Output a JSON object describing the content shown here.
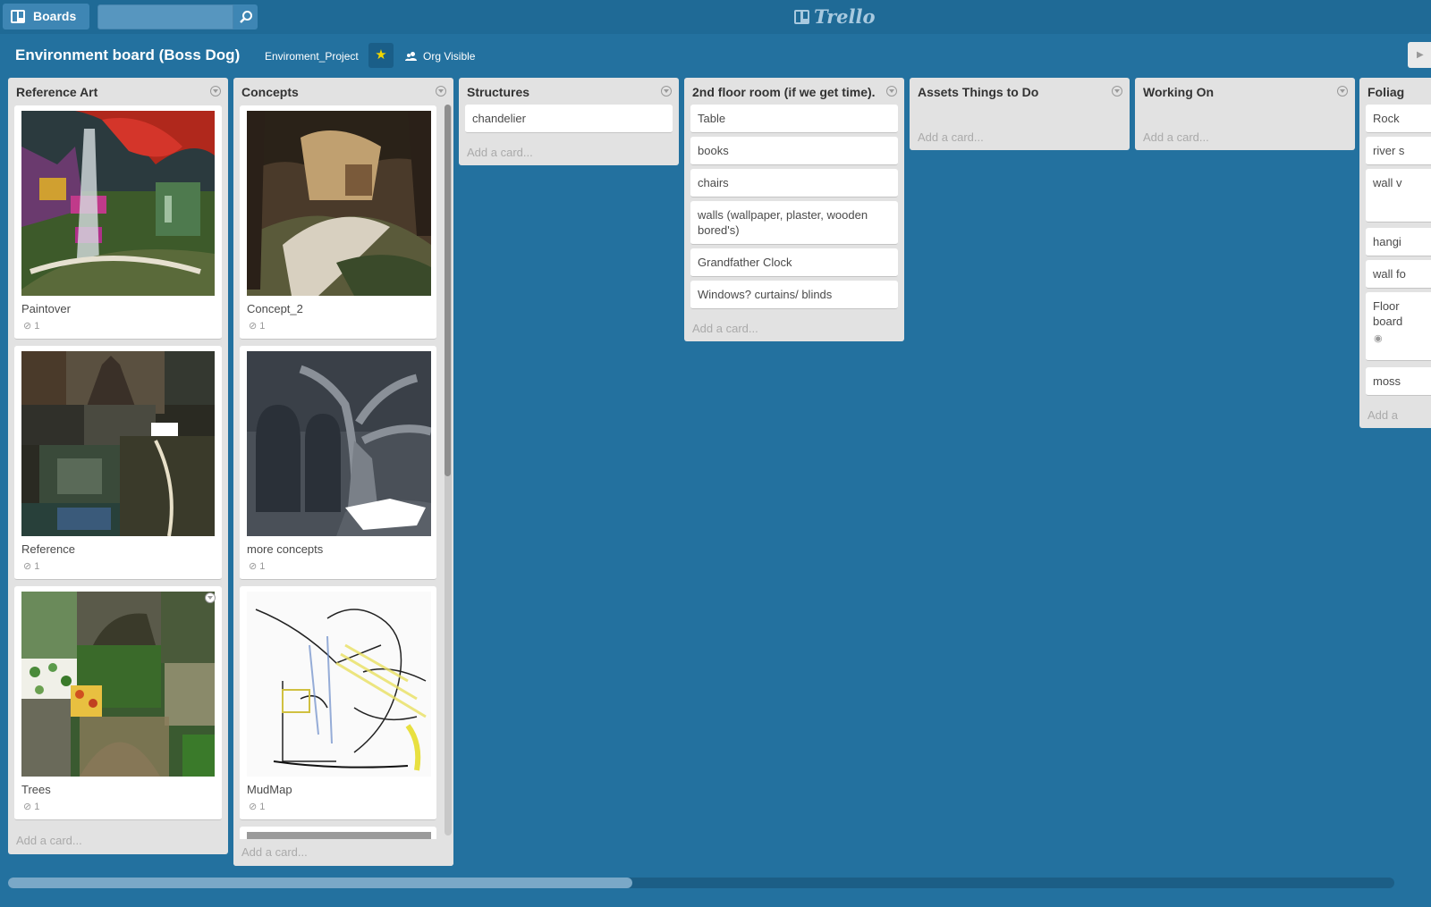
{
  "header": {
    "boards_label": "Boards",
    "search_value": "",
    "logo_text": "Trello"
  },
  "board": {
    "title": "Environment board (Boss Dog)",
    "org": "Enviroment_Project",
    "starred": true,
    "visibility": "Org Visible",
    "add_card_label": "Add a card..."
  },
  "lists": [
    {
      "title": "Reference Art",
      "cards": [
        {
          "title": "Paintover",
          "attachments": "1",
          "cover": "painterly-forest-image"
        },
        {
          "title": "Reference",
          "attachments": "1",
          "cover": "castle-collage-image"
        },
        {
          "title": "Trees",
          "attachments": "1",
          "cover": "trees-collage-image"
        }
      ]
    },
    {
      "title": "Concepts",
      "cards": [
        {
          "title": "Concept_2",
          "attachments": "1",
          "cover": "cave-concept-image"
        },
        {
          "title": "more concepts",
          "attachments": "1",
          "cover": "3d-tree-room-image"
        },
        {
          "title": "MudMap",
          "attachments": "1",
          "cover": "sketch-image"
        }
      ]
    },
    {
      "title": "Structures",
      "cards": [
        {
          "title": "chandelier"
        }
      ]
    },
    {
      "title": "2nd floor room (if we get time).",
      "cards": [
        {
          "title": "Table"
        },
        {
          "title": "books"
        },
        {
          "title": "chairs"
        },
        {
          "title": "walls (wallpaper, plaster, wooden bored's)"
        },
        {
          "title": "Grandfather Clock"
        },
        {
          "title": "Windows? curtains/ blinds"
        }
      ]
    },
    {
      "title": "Assets Things to Do",
      "cards": []
    },
    {
      "title": "Working On",
      "cards": []
    },
    {
      "title": "Foliag",
      "cards": [
        {
          "title": "Rock"
        },
        {
          "title": "river s"
        },
        {
          "title": "wall v"
        },
        {
          "title": "hangi"
        },
        {
          "title": "wall fo"
        },
        {
          "title": "Floor board"
        },
        {
          "title": "moss"
        }
      ],
      "add_card_partial": "Add a"
    }
  ],
  "colors": {
    "board_bg": "#23719f",
    "topbar": "#1f6a96",
    "list_bg": "#e2e2e2",
    "star": "#f2d600"
  }
}
